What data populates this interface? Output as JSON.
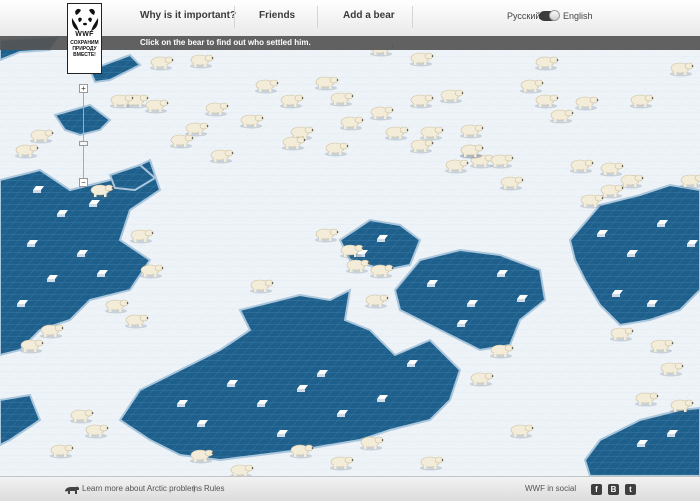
{
  "header": {
    "nav": [
      {
        "label": "Why is it important?"
      },
      {
        "label": "Friends"
      },
      {
        "label": "Add a bear"
      }
    ],
    "lang_ru": "Русский",
    "lang_en": "English"
  },
  "logo": {
    "brand": "WWF",
    "slogan_line1": "СОХРАНИМ",
    "slogan_line2": "ПРИРОДУ",
    "slogan_line3": "ВМЕСТЕ!"
  },
  "hint": "Click on the bear to find out who settled him.",
  "zoom": {
    "plus": "+",
    "minus": "−"
  },
  "footer": {
    "learn_more": "Learn more about Arctic problems",
    "separator": "|",
    "rules": "Rules",
    "wwf_social": "WWF in social",
    "social": [
      {
        "name": "facebook-icon",
        "glyph": "f"
      },
      {
        "name": "vkontakte-icon",
        "glyph": "B"
      },
      {
        "name": "twitter-icon",
        "glyph": "t"
      }
    ]
  },
  "colors": {
    "ice": "#eef3f8",
    "water": "#1f5f8b",
    "water_edge": "#3d7faa",
    "bear": "#f3ecd8"
  }
}
